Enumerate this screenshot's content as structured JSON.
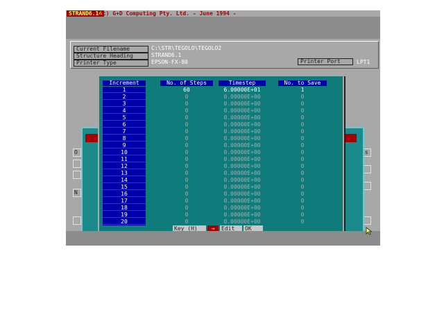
{
  "title_bar": {
    "app_name": "STRAND6.14",
    "copyright": "(c) G+D Computing Pty. Ltd. - June 1994 -"
  },
  "info": {
    "current_filename_label": "Current Filename",
    "current_filename_value": "C:\\STR\\TEGOLO\\TEGOLO2",
    "structure_heading_label": "Structure Heading",
    "structure_heading_value": "STRAND6.1",
    "printer_type_label": "Printer Type",
    "printer_type_value": "EPSON-FX-80",
    "printer_port_label": "Printer Port",
    "printer_port_value": "LPT1"
  },
  "table": {
    "headers": [
      "Increment",
      "No. of Steps",
      "Timestep",
      "No. to Save"
    ],
    "rows": [
      {
        "inc": "1",
        "steps": "60",
        "timestep": "6.00000E+01",
        "save": "1"
      },
      {
        "inc": "2",
        "steps": "0",
        "timestep": "0.00000E+00",
        "save": "0"
      },
      {
        "inc": "3",
        "steps": "0",
        "timestep": "0.00000E+00",
        "save": "0"
      },
      {
        "inc": "4",
        "steps": "0",
        "timestep": "0.00000E+00",
        "save": "0"
      },
      {
        "inc": "5",
        "steps": "0",
        "timestep": "0.00000E+00",
        "save": "0"
      },
      {
        "inc": "6",
        "steps": "0",
        "timestep": "0.00000E+00",
        "save": "0"
      },
      {
        "inc": "7",
        "steps": "0",
        "timestep": "0.00000E+00",
        "save": "0"
      },
      {
        "inc": "8",
        "steps": "0",
        "timestep": "0.00000E+00",
        "save": "0"
      },
      {
        "inc": "9",
        "steps": "0",
        "timestep": "0.00000E+00",
        "save": "0"
      },
      {
        "inc": "10",
        "steps": "0",
        "timestep": "0.00000E+00",
        "save": "0"
      },
      {
        "inc": "11",
        "steps": "0",
        "timestep": "0.00000E+00",
        "save": "0"
      },
      {
        "inc": "12",
        "steps": "0",
        "timestep": "0.00000E+00",
        "save": "0"
      },
      {
        "inc": "13",
        "steps": "0",
        "timestep": "0.00000E+00",
        "save": "0"
      },
      {
        "inc": "14",
        "steps": "0",
        "timestep": "0.00000E+00",
        "save": "0"
      },
      {
        "inc": "15",
        "steps": "0",
        "timestep": "0.00000E+00",
        "save": "0"
      },
      {
        "inc": "16",
        "steps": "0",
        "timestep": "0.00000E+00",
        "save": "0"
      },
      {
        "inc": "17",
        "steps": "0",
        "timestep": "0.00000E+00",
        "save": "0"
      },
      {
        "inc": "18",
        "steps": "0",
        "timestep": "0.00000E+00",
        "save": "0"
      },
      {
        "inc": "19",
        "steps": "0",
        "timestep": "0.00000E+00",
        "save": "0"
      },
      {
        "inc": "20",
        "steps": "0",
        "timestep": "0.00000E+00",
        "save": "0"
      }
    ]
  },
  "commands": {
    "key_label": "Key (H)",
    "arrow_label": "→",
    "edit_label": "Edit",
    "ok_label": "OK"
  },
  "background": {
    "left_letters": [
      "O",
      "N"
    ],
    "right_text": "hs",
    "right_values": [
      "1",
      "6",
      "8"
    ]
  },
  "colors": {
    "dialog_bg": "#0f7b7b",
    "header_blue": "#0000aa",
    "title_red": "#a80000",
    "title_yellow": "#ffff55",
    "screen_gray": "#a8a8a8"
  }
}
